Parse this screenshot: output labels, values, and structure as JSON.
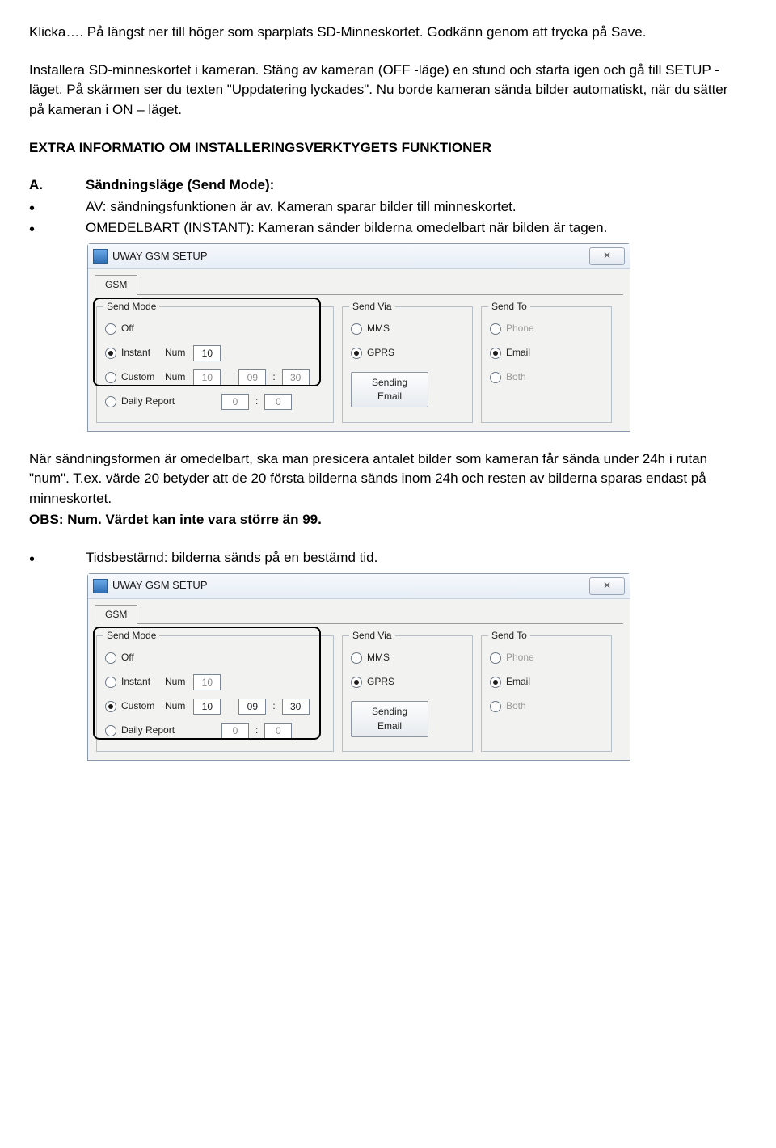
{
  "text": {
    "p1": "Klicka…. På längst ner till höger som sparplats SD-Minneskortet. Godkänn genom att trycka på Save.",
    "p2": "Installera SD-minneskortet i kameran. Stäng av kameran (OFF -läge) en stund och starta igen och gå till SETUP -läget. På skärmen ser du texten \"Uppdatering lyckades\". Nu borde kameran sända bilder automatiskt, när du sätter på kameran i ON – läget.",
    "h1": "EXTRA INFORMATIO OM INSTALLERINGSVERKTYGETS FUNKTIONER",
    "a_marker": "A.",
    "a_title": "Sändningsläge (Send Mode):",
    "a_b1": "AV: sändningsfunktionen är av. Kameran sparar bilder till minneskortet.",
    "a_b2": "OMEDELBART (INSTANT): Kameran sänder bilderna omedelbart när bilden är tagen.",
    "p3": "När sändningsformen är omedelbart, ska man presicera antalet bilder som kameran får sända under 24h i rutan \"num\". T.ex. värde 20 betyder att de 20 första bilderna sänds inom 24h och resten av bilderna sparas endast på minneskortet.",
    "p4": "OBS: Num. Värdet kan inte vara större än 99.",
    "b_b1": "Tidsbestämd: bilderna sänds på en bestämd tid."
  },
  "win": {
    "title": "UWAY GSM SETUP",
    "close": "✕",
    "tab": "GSM",
    "grp_sendmode": "Send Mode",
    "grp_sendvia": "Send Via",
    "grp_sendto": "Send To",
    "off": "Off",
    "instant": "Instant",
    "custom": "Custom",
    "daily": "Daily Report",
    "num": "Num",
    "mms": "MMS",
    "gprs": "GPRS",
    "phone": "Phone",
    "email": "Email",
    "both": "Both",
    "btn_send_l1": "Sending",
    "btn_send_l2": "Email"
  },
  "win1": {
    "instant_num": "10",
    "custom_num": "10",
    "custom_h": "09",
    "custom_m": "30",
    "daily_h": "0",
    "daily_m": "0"
  },
  "win2": {
    "instant_num": "10",
    "custom_num": "10",
    "custom_h": "09",
    "custom_m": "30",
    "daily_h": "0",
    "daily_m": "0"
  }
}
